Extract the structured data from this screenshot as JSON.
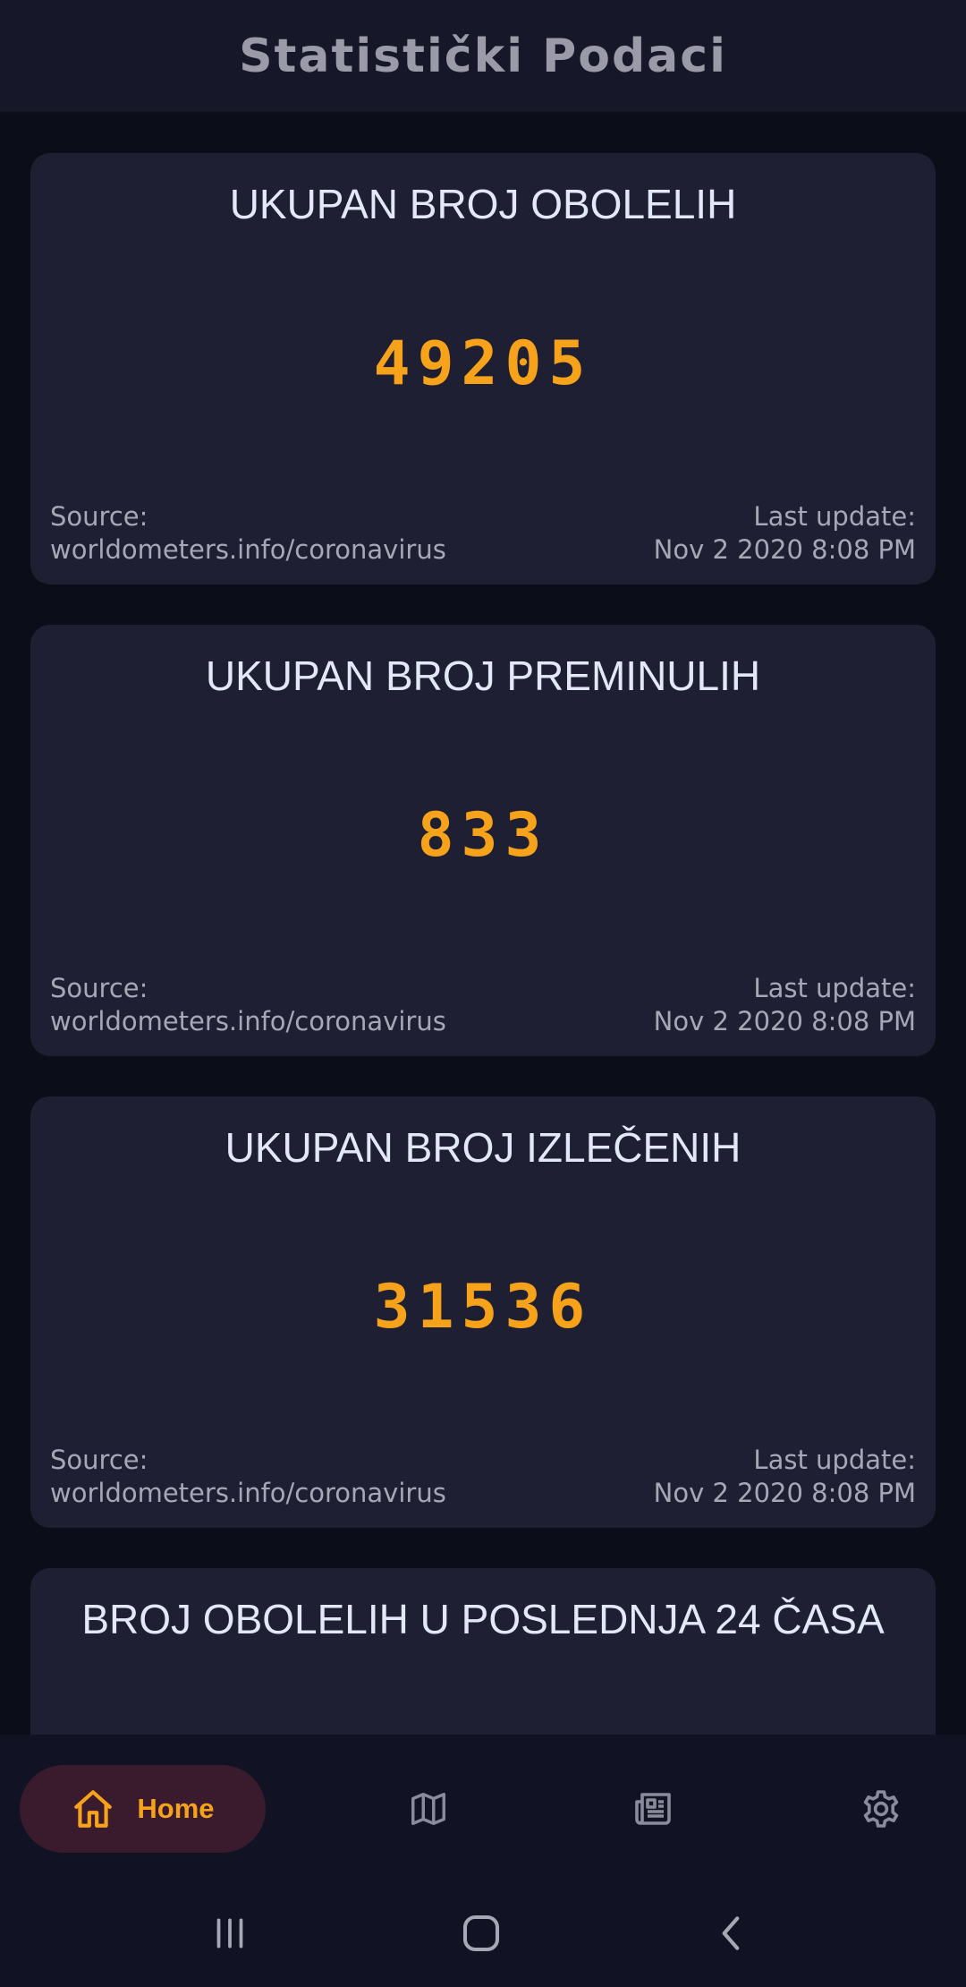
{
  "app_bar": {
    "title": "Statistički Podaci"
  },
  "cards": [
    {
      "title": "UKUPAN BROJ OBOLELIH",
      "value": "49205",
      "source_label": "Source:",
      "source_value": "worldometers.info/coronavirus",
      "update_label": "Last update:",
      "update_value": "Nov 2 2020 8:08 PM"
    },
    {
      "title": "UKUPAN BROJ PREMINULIH",
      "value": "833",
      "source_label": "Source:",
      "source_value": "worldometers.info/coronavirus",
      "update_label": "Last update:",
      "update_value": "Nov 2 2020 8:08 PM"
    },
    {
      "title": "UKUPAN BROJ IZLEČENIH",
      "value": "31536",
      "source_label": "Source:",
      "source_value": "worldometers.info/coronavirus",
      "update_label": "Last update:",
      "update_value": "Nov 2 2020 8:08 PM"
    },
    {
      "title": "BROJ OBOLELIH U POSLEDNJA 24 ČASA"
    }
  ],
  "bottom_nav": {
    "items": [
      {
        "label": "Home",
        "icon": "home-icon",
        "active": true
      },
      {
        "label": "",
        "icon": "map-icon",
        "active": false
      },
      {
        "label": "",
        "icon": "news-icon",
        "active": false
      },
      {
        "label": "",
        "icon": "gear-icon",
        "active": false
      }
    ],
    "active_color": "#f7a21b",
    "inactive_color": "#8a8c9c"
  },
  "system_nav": {
    "buttons": [
      "recent-apps-icon",
      "home-circle-icon",
      "back-icon"
    ]
  },
  "colors": {
    "background": "#0b0d19",
    "card": "#1e1f33",
    "accent": "#f7a21b",
    "title_text": "#e3e8f7"
  }
}
